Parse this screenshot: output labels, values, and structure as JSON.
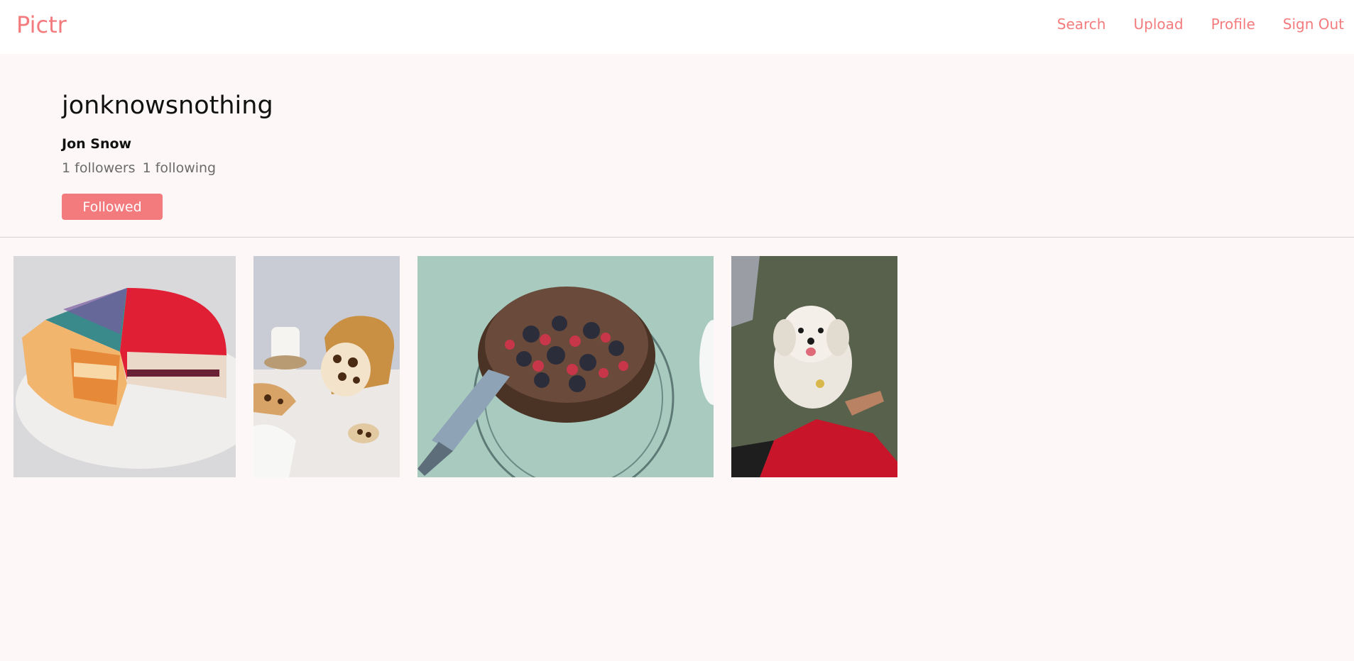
{
  "nav": {
    "brand": "Pictr",
    "links": [
      "Search",
      "Upload",
      "Profile",
      "Sign Out"
    ]
  },
  "profile": {
    "username": "jonknowsnothing",
    "full_name": "Jon Snow",
    "followers": "1 followers",
    "following": "1 following",
    "follow_button": "Followed"
  },
  "colors": {
    "accent": "#f47b7d",
    "page_background": "#fdf8f7"
  },
  "photos": [
    "cake-slice-photo",
    "leopard-bread-photo",
    "berry-tart-photo",
    "dog-photo"
  ]
}
